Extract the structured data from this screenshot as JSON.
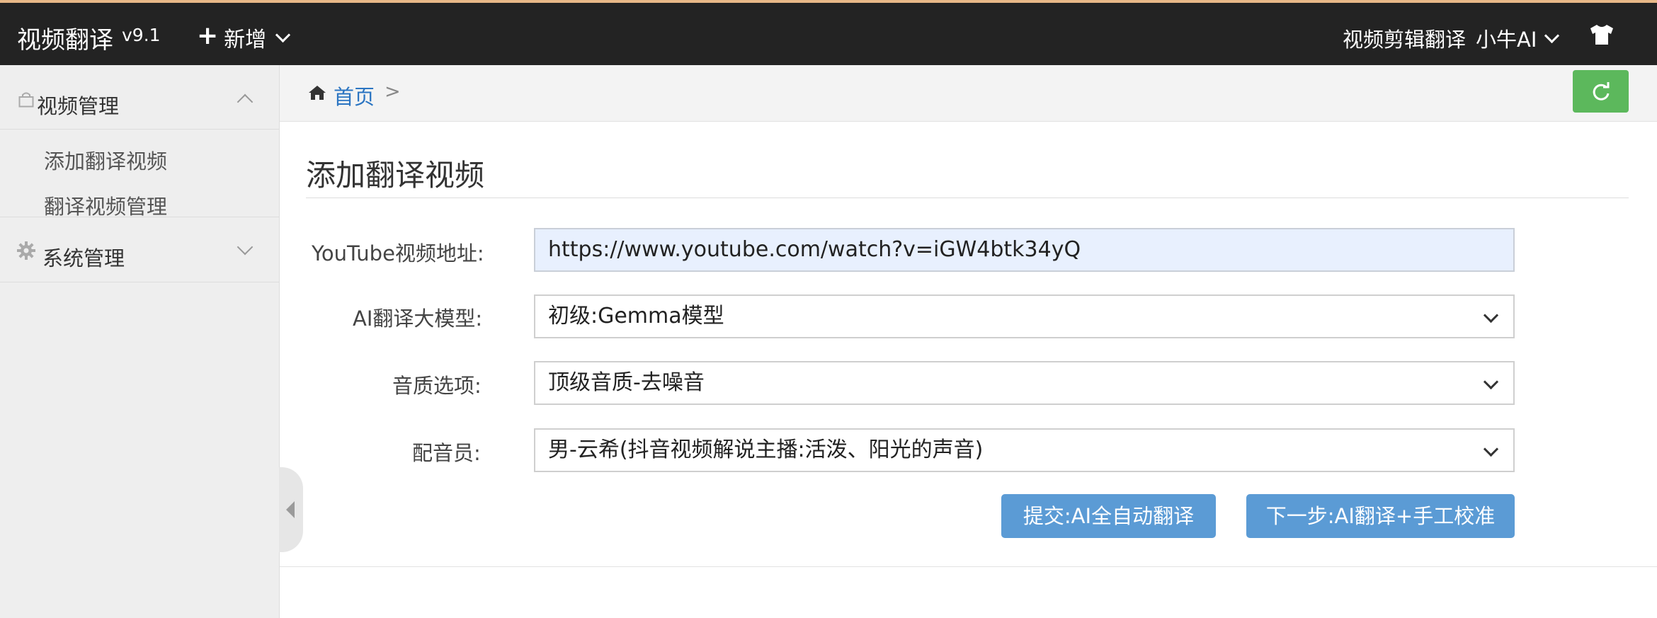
{
  "header": {
    "app_title": "视频翻译",
    "version": "v9.1",
    "new_menu": {
      "icon": "plus-icon",
      "label": "新增"
    },
    "editing_link": "视频剪辑翻译",
    "user_menu": "小牛AI",
    "theme_icon": "tshirt-icon"
  },
  "sidebar": {
    "groups": [
      {
        "label": "视频管理",
        "icon": "bag-icon",
        "expanded": true,
        "items": [
          {
            "label": "添加翻译视频"
          },
          {
            "label": "翻译视频管理"
          }
        ]
      },
      {
        "label": "系统管理",
        "icon": "gear-icon",
        "expanded": false,
        "items": []
      }
    ]
  },
  "breadcrumb": {
    "home": "首页",
    "separator": ">"
  },
  "main": {
    "title": "添加翻译视频",
    "form": {
      "url": {
        "label": "YouTube视频地址:",
        "value": "https://www.youtube.com/watch?v=iGW4btk34yQ"
      },
      "model": {
        "label": "AI翻译大模型:",
        "value": "初级:Gemma模型"
      },
      "audio": {
        "label": "音质选项:",
        "value": "顶级音质-去噪音"
      },
      "voice": {
        "label": "配音员:",
        "value": "男-云希(抖音视频解说主播:活泼、阳光的声音)"
      }
    },
    "buttons": {
      "submit": "提交:AI全自动翻译",
      "next": "下一步:AI翻译+手工校准"
    }
  },
  "colors": {
    "topbar": "#232323",
    "accent_border": "#e8b888",
    "link": "#2b75c2",
    "refresh_button": "#5cb85c",
    "primary_button": "#5b9bd5",
    "input_autofill": "#e8f0fe"
  }
}
